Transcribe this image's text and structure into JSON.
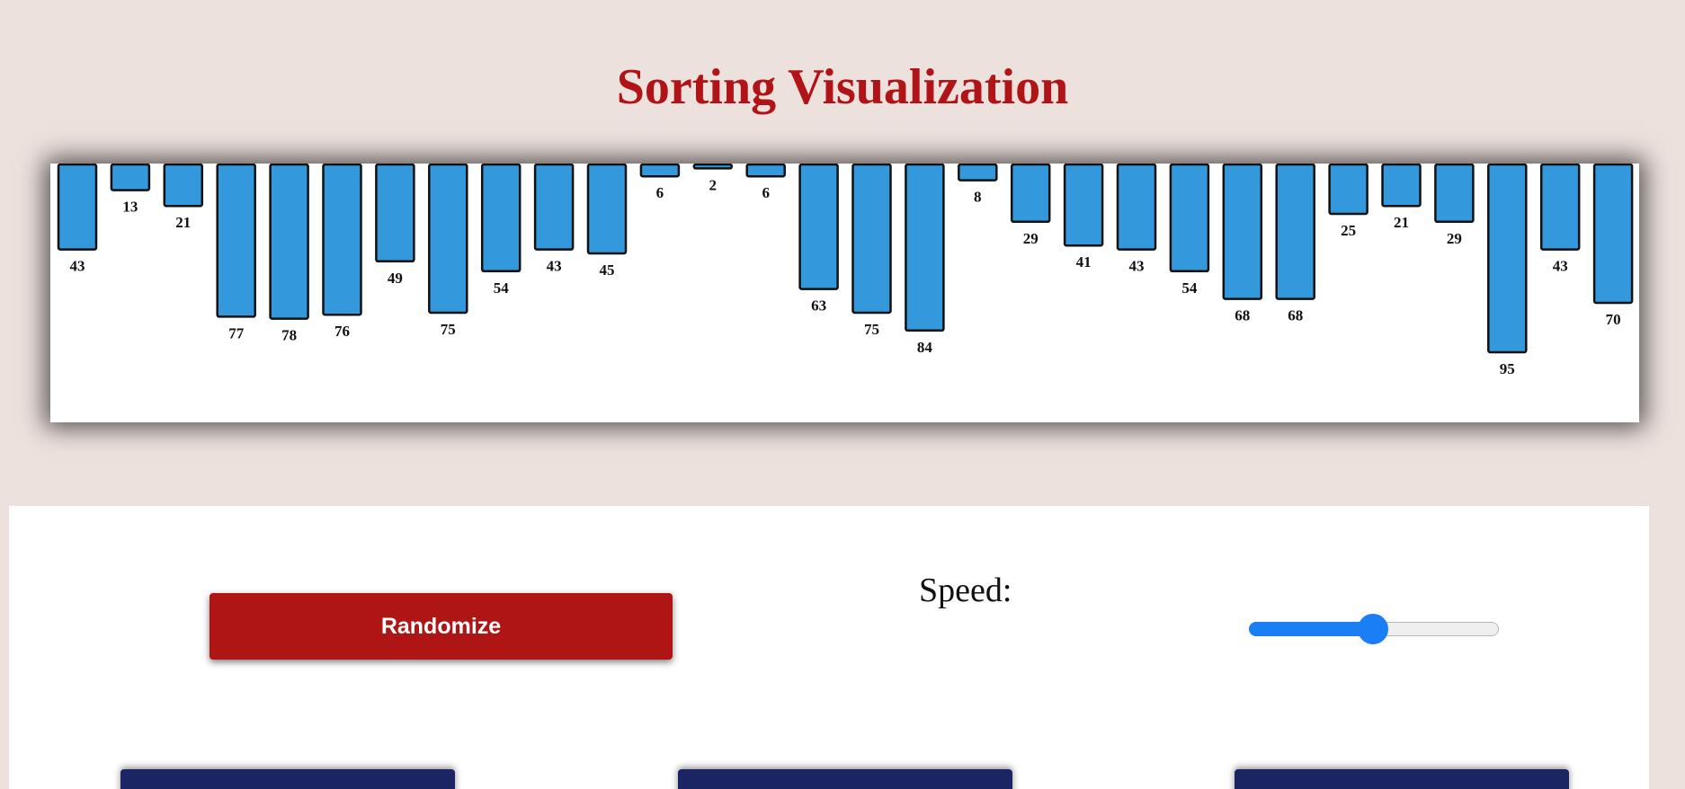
{
  "page": {
    "title": "Sorting Visualization"
  },
  "colors": {
    "background": "#ede1de",
    "title": "#b01417",
    "bar_fill": "#3398dc",
    "bar_stroke": "#111111",
    "randomize_button": "#b01516",
    "algorithm_buttons": "#1b2564",
    "slider_accent": "#1a7ef5"
  },
  "bars": {
    "values": [
      43,
      13,
      21,
      77,
      78,
      76,
      49,
      75,
      54,
      43,
      45,
      6,
      2,
      6,
      63,
      75,
      84,
      8,
      29,
      41,
      43,
      54,
      68,
      68,
      25,
      21,
      29,
      95,
      43,
      70
    ]
  },
  "controls": {
    "randomize_label": "Randomize",
    "speed_label": "Speed:",
    "speed_value_fraction": 0.5,
    "algorithm_buttons": [
      "",
      "",
      ""
    ]
  }
}
